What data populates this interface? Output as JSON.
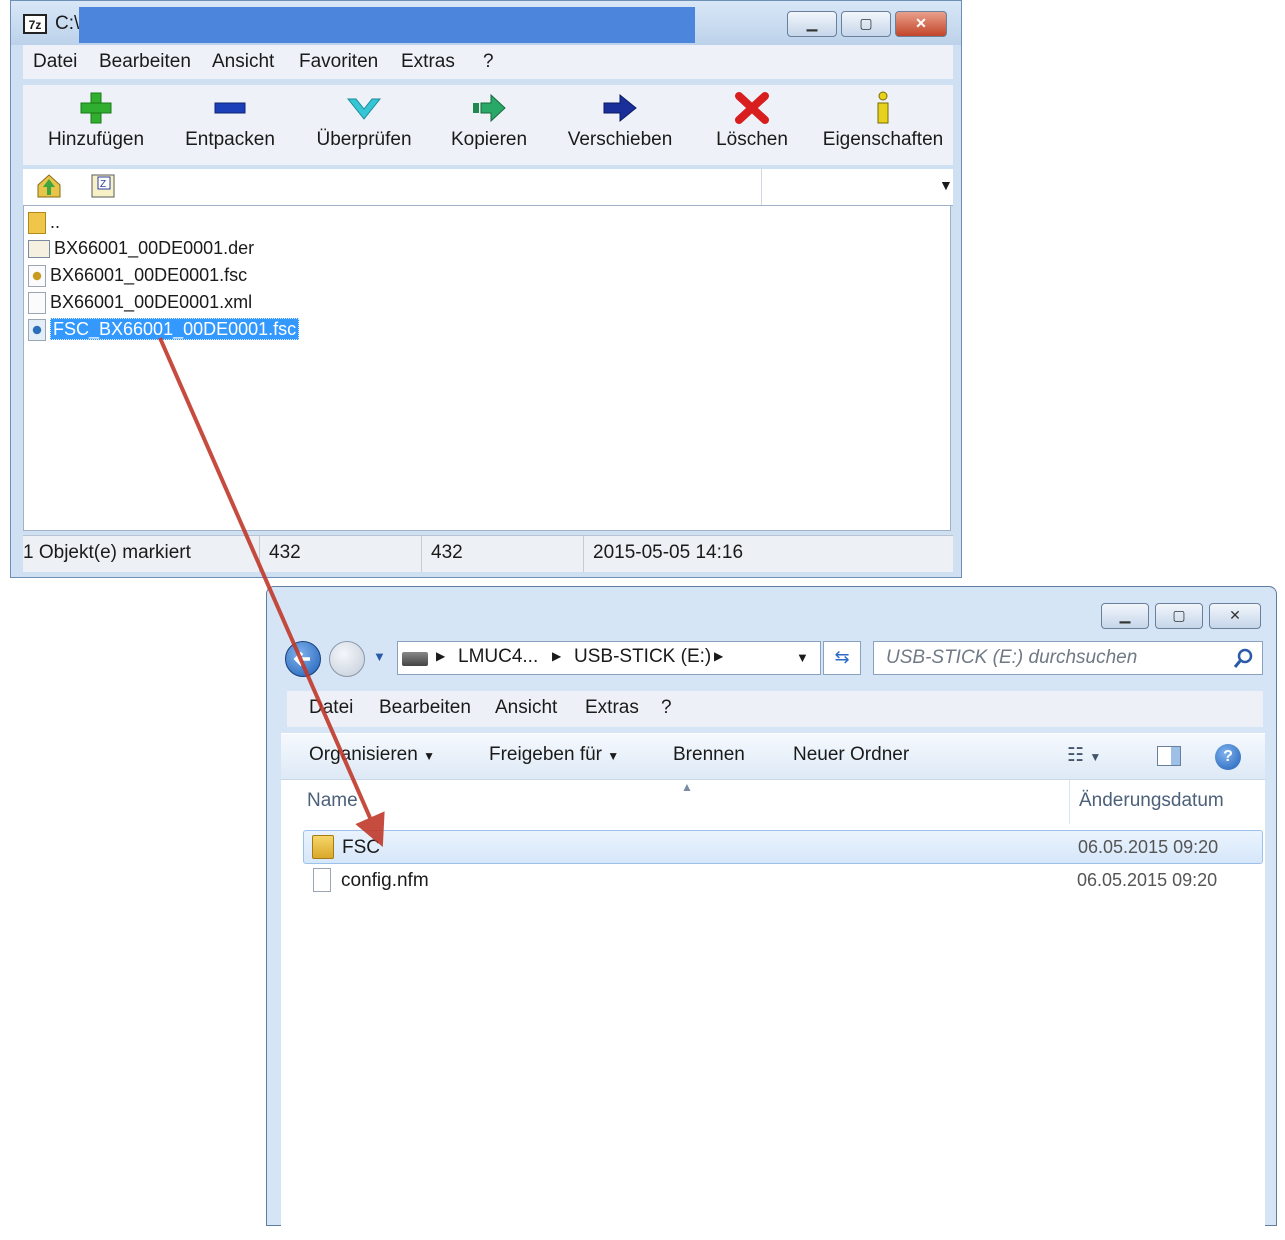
{
  "zip": {
    "title": "C:\\",
    "menu": [
      "Datei",
      "Bearbeiten",
      "Ansicht",
      "Favoriten",
      "Extras",
      "?"
    ],
    "toolbar": [
      {
        "label": "Hinzufügen",
        "icon": "plus-icon"
      },
      {
        "label": "Entpacken",
        "icon": "minus-icon"
      },
      {
        "label": "Überprüfen",
        "icon": "check-icon"
      },
      {
        "label": "Kopieren",
        "icon": "copy-arrow-icon"
      },
      {
        "label": "Verschieben",
        "icon": "move-arrow-icon"
      },
      {
        "label": "Löschen",
        "icon": "delete-x-icon"
      },
      {
        "label": "Eigenschaften",
        "icon": "info-icon"
      }
    ],
    "files": [
      {
        "name": "..",
        "type": "parent-folder"
      },
      {
        "name": "BX66001_00DE0001.der",
        "type": "certificate"
      },
      {
        "name": "BX66001_00DE0001.fsc",
        "type": "fsc"
      },
      {
        "name": "BX66001_00DE0001.xml",
        "type": "xml"
      },
      {
        "name": "FSC_BX66001_00DE0001.fsc",
        "type": "fsc",
        "selected": true
      }
    ],
    "status": {
      "selection": "1 Objekt(e) markiert",
      "size": "432",
      "packed_size": "432",
      "modified": "2015-05-05 14:16"
    }
  },
  "explorer": {
    "breadcrumb": [
      "LMUC4...",
      "USB-STICK (E:)"
    ],
    "search_placeholder": "USB-STICK (E:) durchsuchen",
    "menu": [
      "Datei",
      "Bearbeiten",
      "Ansicht",
      "Extras",
      "?"
    ],
    "commands": {
      "organize": "Organisieren",
      "share": "Freigeben für",
      "burn": "Brennen",
      "new_folder": "Neuer Ordner"
    },
    "columns": {
      "name": "Name",
      "date": "Änderungsdatum"
    },
    "files": [
      {
        "name": "FSC",
        "date": "06.05.2015 09:20",
        "type": "folder"
      },
      {
        "name": "config.nfm",
        "date": "06.05.2015 09:20",
        "type": "file"
      }
    ]
  },
  "colors": {
    "selection": "#3399ff",
    "arrow": "#c0392b",
    "title_redaction": "#4c86dc"
  }
}
